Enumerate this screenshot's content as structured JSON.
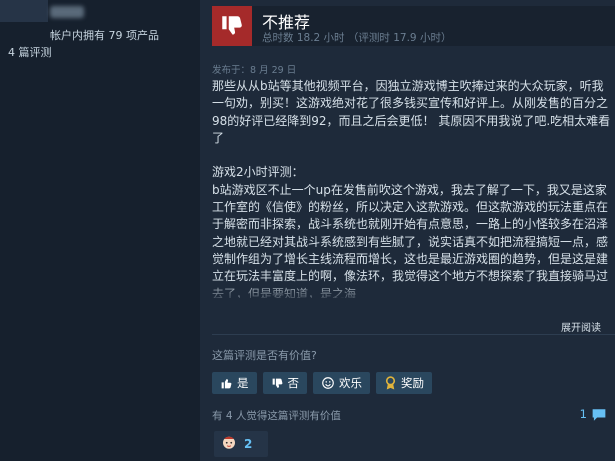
{
  "profile": {
    "owned_text": "帐户内拥有 79 项产品",
    "reviews_text": "4 篇评测"
  },
  "review": {
    "verdict": "不推荐",
    "hours": "总时数 18.2 小时   （评测时 17.9 小时）",
    "posted": "发布于：8 月 29 日",
    "text": "那些从从b站等其他视频平台，因独立游戏博主吹捧过来的大众玩家，听我一句劝，别买！这游戏绝对花了很多钱买宣传和好评上。从刚发售的百分之98的好评已经降到92，而且之后会更低！ 其原因不用我说了吧.吃相太难看了\n\n游戏2小时评测：\nb站游戏区不止一个up在发售前吹这个游戏，我去了解了一下，我又是这家工作室的《信使》的粉丝，所以决定入这款游戏。但这款游戏的玩法重点在于解密而非探索，战斗系统也就刚开始有点意思，一路上的小怪较多在沼泽之地就已经对其战斗系统感到有些腻了，说实话真不如把流程搞短一点，感觉制作组为了增长主线流程而增长，这也是最近游戏圈的趋势，但是这是建立在玩法丰富度上的啊，像法环，我觉得这个地方不想探索了我直接骑马过去了，但是要知道，是之海",
    "expand_label": "展开阅读"
  },
  "feedback": {
    "question": "这篇评测是否有价值?",
    "yes_label": "是",
    "no_label": "否",
    "funny_label": "欢乐",
    "award_label": "奖励",
    "found_helpful": "有 4 人觉得这篇评测有价值",
    "comment_count": "1",
    "award_count": "2"
  },
  "colors": {
    "verdict_red": "#a52a2a",
    "link_blue": "#66c0f4",
    "button_bg": "#2a475e"
  },
  "icons": [
    "thumbs-down-icon",
    "thumbs-up-icon",
    "smile-icon",
    "award-icon",
    "comment-icon",
    "award-emoji-icon"
  ]
}
